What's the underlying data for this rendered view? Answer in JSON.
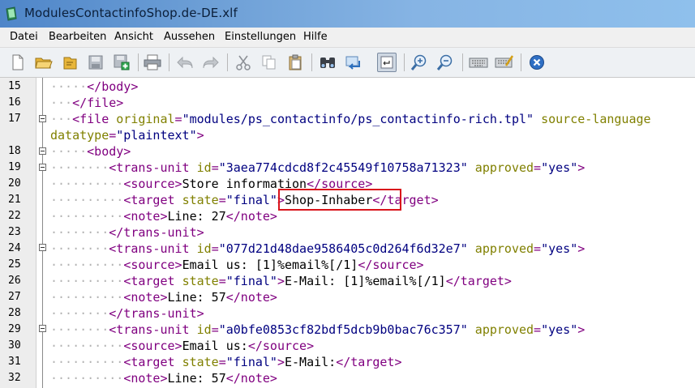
{
  "window": {
    "title": "ModulesContactinfoShop.de-DE.xlf"
  },
  "menu": [
    "Datei",
    "Bearbeiten",
    "Ansicht",
    "Aussehen",
    "Einstellungen",
    "Hilfe"
  ],
  "toolbar": {
    "icons": [
      "new-file-icon",
      "open-folder-icon",
      "open-recent-icon",
      "save-icon",
      "save-as-icon",
      "print-icon",
      "undo-icon",
      "redo-icon",
      "cut-icon",
      "copy-icon",
      "paste-icon",
      "find-icon",
      "replace-icon",
      "word-wrap-icon",
      "zoom-in-icon",
      "zoom-out-icon",
      "keyboard-icon",
      "edit-settings-icon",
      "close-icon"
    ]
  },
  "editor": {
    "lines": [
      {
        "num": "15",
        "indent": "·····",
        "parts": [
          [
            "tag",
            "</body>"
          ]
        ]
      },
      {
        "num": "16",
        "indent": "···",
        "parts": [
          [
            "tag",
            "</file>"
          ]
        ]
      },
      {
        "num": "17",
        "indent": "···",
        "parts": [
          [
            "tag",
            "<file "
          ],
          [
            "attr",
            "original"
          ],
          [
            "tag",
            "="
          ],
          [
            "str",
            "\"modules/ps_contactinfo/ps_contactinfo-rich.tpl\""
          ],
          [
            "txt",
            " "
          ],
          [
            "attr",
            "source-language"
          ]
        ]
      },
      {
        "num": "",
        "indent": "",
        "parts": [
          [
            "attr",
            "datatype"
          ],
          [
            "tag",
            "="
          ],
          [
            "str",
            "\"plaintext\""
          ],
          [
            "tag",
            ">"
          ]
        ]
      },
      {
        "num": "18",
        "indent": "·····",
        "parts": [
          [
            "tag",
            "<body>"
          ]
        ]
      },
      {
        "num": "19",
        "indent": "········",
        "parts": [
          [
            "tag",
            "<trans-unit "
          ],
          [
            "attr",
            "id"
          ],
          [
            "tag",
            "="
          ],
          [
            "str",
            "\"3aea774cdcd8f2c45549f10758a71323\""
          ],
          [
            "txt",
            " "
          ],
          [
            "attr",
            "approved"
          ],
          [
            "tag",
            "="
          ],
          [
            "str",
            "\"yes\""
          ],
          [
            "tag",
            ">"
          ]
        ]
      },
      {
        "num": "20",
        "indent": "··········",
        "parts": [
          [
            "tag",
            "<source>"
          ],
          [
            "txt",
            "Store information"
          ],
          [
            "tag",
            "</source>"
          ]
        ]
      },
      {
        "num": "21",
        "indent": "··········",
        "parts": [
          [
            "tag",
            "<target "
          ],
          [
            "attr",
            "state"
          ],
          [
            "tag",
            "="
          ],
          [
            "str",
            "\"final\""
          ],
          [
            "tag",
            ">"
          ],
          [
            "txt",
            "Shop-Inhaber"
          ],
          [
            "tag",
            "</target>"
          ]
        ]
      },
      {
        "num": "22",
        "indent": "··········",
        "parts": [
          [
            "tag",
            "<note>"
          ],
          [
            "txt",
            "Line: 27"
          ],
          [
            "tag",
            "</note>"
          ]
        ]
      },
      {
        "num": "23",
        "indent": "········",
        "parts": [
          [
            "tag",
            "</trans-unit>"
          ]
        ]
      },
      {
        "num": "24",
        "indent": "········",
        "parts": [
          [
            "tag",
            "<trans-unit "
          ],
          [
            "attr",
            "id"
          ],
          [
            "tag",
            "="
          ],
          [
            "str",
            "\"077d21d48dae9586405c0d264f6d32e7\""
          ],
          [
            "txt",
            " "
          ],
          [
            "attr",
            "approved"
          ],
          [
            "tag",
            "="
          ],
          [
            "str",
            "\"yes\""
          ],
          [
            "tag",
            ">"
          ]
        ]
      },
      {
        "num": "25",
        "indent": "··········",
        "parts": [
          [
            "tag",
            "<source>"
          ],
          [
            "txt",
            "Email us: [1]%email%[/1]"
          ],
          [
            "tag",
            "</source>"
          ]
        ]
      },
      {
        "num": "26",
        "indent": "··········",
        "parts": [
          [
            "tag",
            "<target "
          ],
          [
            "attr",
            "state"
          ],
          [
            "tag",
            "="
          ],
          [
            "str",
            "\"final\""
          ],
          [
            "tag",
            ">"
          ],
          [
            "txt",
            "E-Mail: [1]%email%[/1]"
          ],
          [
            "tag",
            "</target>"
          ]
        ]
      },
      {
        "num": "27",
        "indent": "··········",
        "parts": [
          [
            "tag",
            "<note>"
          ],
          [
            "txt",
            "Line: 57"
          ],
          [
            "tag",
            "</note>"
          ]
        ]
      },
      {
        "num": "28",
        "indent": "········",
        "parts": [
          [
            "tag",
            "</trans-unit>"
          ]
        ]
      },
      {
        "num": "29",
        "indent": "········",
        "parts": [
          [
            "tag",
            "<trans-unit "
          ],
          [
            "attr",
            "id"
          ],
          [
            "tag",
            "="
          ],
          [
            "str",
            "\"a0bfe0853cf82bdf5dcb9b0bac76c357\""
          ],
          [
            "txt",
            " "
          ],
          [
            "attr",
            "approved"
          ],
          [
            "tag",
            "="
          ],
          [
            "str",
            "\"yes\""
          ],
          [
            "tag",
            ">"
          ]
        ]
      },
      {
        "num": "30",
        "indent": "··········",
        "parts": [
          [
            "tag",
            "<source>"
          ],
          [
            "txt",
            "Email us:"
          ],
          [
            "tag",
            "</source>"
          ]
        ]
      },
      {
        "num": "31",
        "indent": "··········",
        "parts": [
          [
            "tag",
            "<target "
          ],
          [
            "attr",
            "state"
          ],
          [
            "tag",
            "="
          ],
          [
            "str",
            "\"final\""
          ],
          [
            "tag",
            ">"
          ],
          [
            "txt",
            "E-Mail:"
          ],
          [
            "tag",
            "</target>"
          ]
        ]
      },
      {
        "num": "32",
        "indent": "··········",
        "parts": [
          [
            "tag",
            "<note>"
          ],
          [
            "txt",
            "Line: 57"
          ],
          [
            "tag",
            "</note>"
          ]
        ]
      }
    ]
  },
  "colors": {
    "tag": "#800080",
    "attr": "#808000",
    "string": "#000080",
    "highlight": "#d9141b"
  }
}
